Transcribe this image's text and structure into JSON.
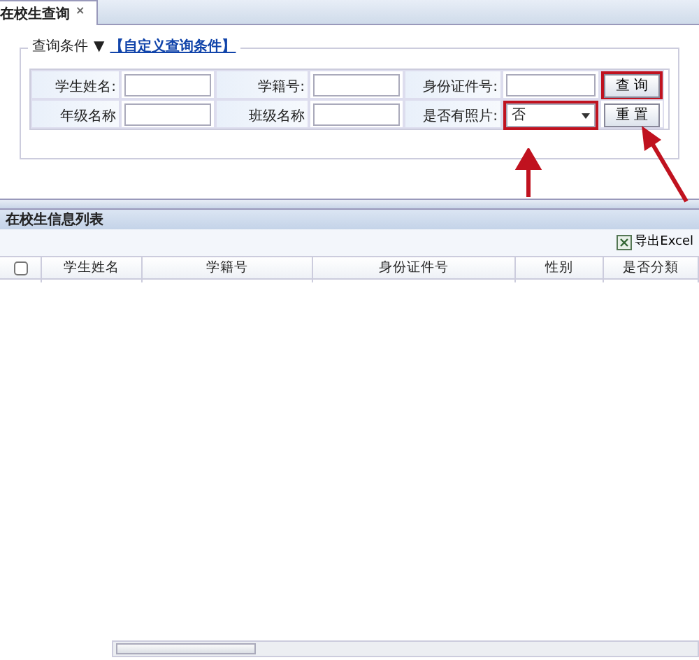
{
  "tabs": [
    {
      "label": "在校生查询",
      "selected": true,
      "close": "×"
    }
  ],
  "query": {
    "title": "查询条件",
    "toggle": "▼",
    "custom_link": "【自定义查询条件】",
    "rows": [
      [
        {
          "label": "学生姓名:",
          "kind": "input"
        },
        {
          "label": "学籍号:",
          "kind": "input"
        },
        {
          "label": "身份证件号:",
          "kind": "input"
        },
        {
          "kind": "button",
          "label": "查 询",
          "highlighted": true
        }
      ],
      [
        {
          "label": "年级名称",
          "kind": "input"
        },
        {
          "label": "班级名称",
          "kind": "input"
        },
        {
          "label": "是否有照片:",
          "kind": "select",
          "value": "否",
          "highlighted": true
        },
        {
          "kind": "button",
          "label": "重 置",
          "highlighted": false
        }
      ]
    ]
  },
  "list": {
    "title": "在校生信息列表",
    "export": "导出Excel",
    "columns": [
      "学生姓名",
      "学籍号",
      "身份证件号",
      "性别",
      "是否分類"
    ],
    "select_all_checked": false
  }
}
